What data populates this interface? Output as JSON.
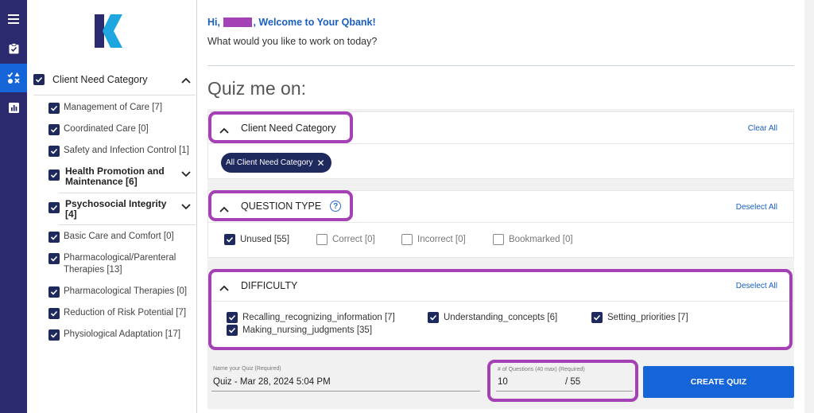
{
  "rail": {
    "icons": [
      "menu-icon",
      "clipboard-check-icon",
      "quiz-tools-icon",
      "bar-chart-icon"
    ]
  },
  "sidebar": {
    "header": "Client Need Category",
    "items": [
      {
        "label": "Management of Care [7]"
      },
      {
        "label": "Coordinated Care [0]"
      },
      {
        "label": "Safety and Infection Control [1]"
      },
      {
        "label": "Health Promotion and Maintenance [6]",
        "group": true
      },
      {
        "label": "Psychosocial Integrity [4]",
        "group": true
      },
      {
        "label": "Basic Care and Comfort [0]"
      },
      {
        "label": "Pharmacological/Parenteral Therapies [13]"
      },
      {
        "label": "Pharmacological Therapies [0]"
      },
      {
        "label": "Reduction of Risk Potential [7]"
      },
      {
        "label": "Physiological Adaptation [17]"
      }
    ]
  },
  "header": {
    "greeting_prefix": "Hi,",
    "greeting_suffix": ", Welcome to Your Qbank!",
    "subtitle": "What would you like to work on today?"
  },
  "quiz_title": "Quiz me on:",
  "client_need": {
    "title": "Client Need Category",
    "action": "Clear All",
    "chip": "All Client Need Category"
  },
  "question_type": {
    "title": "QUESTION TYPE",
    "help": "?",
    "action": "Deselect All",
    "options": [
      {
        "label": "Unused [55]",
        "checked": true
      },
      {
        "label": "Correct [0]",
        "checked": false
      },
      {
        "label": "Incorrect [0]",
        "checked": false
      },
      {
        "label": "Bookmarked [0]",
        "checked": false
      }
    ]
  },
  "difficulty": {
    "title": "DIFFICULTY",
    "action": "Deselect All",
    "options": [
      {
        "label": "Recalling_recognizing_information [7]",
        "checked": true
      },
      {
        "label": "Understanding_concepts [6]",
        "checked": true
      },
      {
        "label": "Setting_priorities [7]",
        "checked": true
      },
      {
        "label": "Making_nursing_judgments [35]",
        "checked": true
      }
    ]
  },
  "quiz_name": {
    "label": "Name your Quiz (Required)",
    "value": "Quiz - Mar 28, 2024 5:04 PM"
  },
  "num_questions": {
    "label": "# of Questions (40 max) (Required)",
    "value": "10",
    "max": "/ 55"
  },
  "create_button": "CREATE QUIZ",
  "colors": {
    "rail": "#2b2a6e",
    "accent": "#1565d8",
    "highlight": "#a441b5",
    "checkbox": "#1e2a5e"
  }
}
